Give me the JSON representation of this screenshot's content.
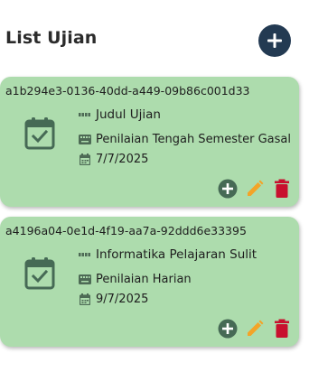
{
  "header": {
    "title": "List Ujian",
    "add_button_icon": "add-circle-icon"
  },
  "colors": {
    "card_background": "#addcad",
    "primary": "#233a52",
    "icon_green": "#466a55",
    "edit": "#f3a428",
    "delete": "#c8102e"
  },
  "exams": [
    {
      "id": "a1b294e3-0136-40dd-a449-09b86c001d33",
      "title": "Judul Ujian",
      "type": "Penilaian Tengah Semester Gasal",
      "date": "7/7/2025"
    },
    {
      "id": "a4196a04-0e1d-4f19-aa7a-92ddd6e33395",
      "title": "Informatika Pelajaran Sulit",
      "type": "Penilaian Harian",
      "date": "9/7/2025"
    }
  ]
}
